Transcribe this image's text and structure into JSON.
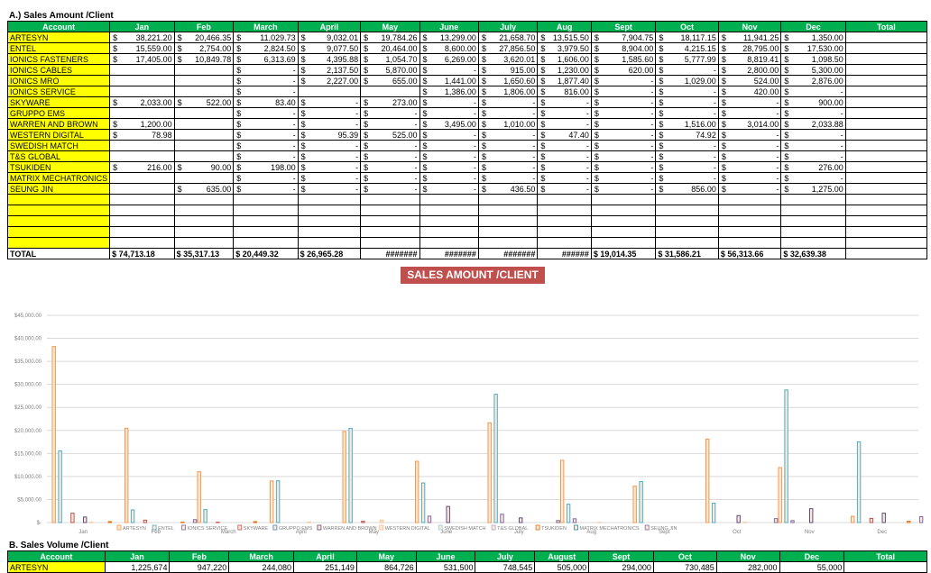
{
  "sectionA": {
    "title": "A.) Sales Amount /Client",
    "headers": [
      "Account",
      "Jan",
      "Feb",
      "March",
      "April",
      "May",
      "June",
      "July",
      "Aug",
      "Sept",
      "Oct",
      "Nov",
      "Dec",
      "Total"
    ],
    "rows": [
      {
        "account": "ARTESYN",
        "values": [
          "38,221.20",
          "20,466.35",
          "11,029.73",
          "9,032.01",
          "19,784.26",
          "13,299.00",
          "21,658.70",
          "13,515.50",
          "7,904.75",
          "18,117.15",
          "11,941.25",
          "1,350.00",
          ""
        ]
      },
      {
        "account": "ENTEL",
        "values": [
          "15,559.00",
          "2,754.00",
          "2,824.50",
          "9,077.50",
          "20,464.00",
          "8,600.00",
          "27,856.50",
          "3,979.50",
          "8,904.00",
          "4,215.15",
          "28,795.00",
          "17,530.00",
          ""
        ]
      },
      {
        "account": "IONICS FASTENERS",
        "values": [
          "17,405.00",
          "10,849.78",
          "6,313.69",
          "4,395.88",
          "1,054.70",
          "6,269.00",
          "3,620.01",
          "1,606.00",
          "1,585.60",
          "5,777.99",
          "8,819.41",
          "1,098.50",
          ""
        ]
      },
      {
        "account": "IONICS CABLES",
        "values": [
          "",
          "",
          "-",
          "2,137.50",
          "5,870.00",
          "-",
          "915.00",
          "1,230.00",
          "620.00",
          "-",
          "2,800.00",
          "5,300.00",
          ""
        ]
      },
      {
        "account": "IONICS MRO",
        "values": [
          "",
          "",
          "-",
          "2,227.00",
          "655.00",
          "1,441.00",
          "1,650.60",
          "1,877.40",
          "-",
          "1,029.00",
          "524.00",
          "2,876.00",
          ""
        ]
      },
      {
        "account": "IONICS SERVICE",
        "values": [
          "",
          "",
          "-",
          "",
          "",
          "1,386.00",
          "1,806.00",
          "816.00",
          "-",
          "-",
          "420.00",
          "-",
          ""
        ]
      },
      {
        "account": "SKYWARE",
        "values": [
          "2,033.00",
          "522.00",
          "83.40",
          "-",
          "273.00",
          "-",
          "-",
          "-",
          "-",
          "-",
          "-",
          "900.00",
          ""
        ]
      },
      {
        "account": "GRUPPO EMS",
        "values": [
          "",
          "",
          "-",
          "-",
          "-",
          "-",
          "-",
          "-",
          "-",
          "-",
          "-",
          "-",
          ""
        ]
      },
      {
        "account": "WARREN AND BROWN",
        "values": [
          "1,200.00",
          "",
          "-",
          "-",
          "-",
          "3,495.00",
          "1,010.00",
          "-",
          "-",
          "1,516.00",
          "3,014.00",
          "2,033.88",
          ""
        ]
      },
      {
        "account": "WESTERN DIGITAL",
        "values": [
          "78.98",
          "",
          "-",
          "95.39",
          "525.00",
          "-",
          "-",
          "47.40",
          "-",
          "74.92",
          "-",
          "-",
          ""
        ]
      },
      {
        "account": "SWEDISH MATCH",
        "values": [
          "",
          "",
          "-",
          "-",
          "-",
          "-",
          "-",
          "-",
          "-",
          "-",
          "-",
          "-",
          ""
        ]
      },
      {
        "account": "T&S GLOBAL",
        "values": [
          "",
          "",
          "-",
          "-",
          "-",
          "-",
          "-",
          "-",
          "-",
          "-",
          "-",
          "-",
          ""
        ]
      },
      {
        "account": "TSUKIDEN",
        "values": [
          "216.00",
          "90.00",
          "198.00",
          "-",
          "-",
          "-",
          "-",
          "-",
          "-",
          "-",
          "-",
          "276.00",
          ""
        ]
      },
      {
        "account": "MATRIX MECHATRONICS",
        "values": [
          "",
          "",
          "-",
          "-",
          "-",
          "-",
          "-",
          "-",
          "-",
          "-",
          "-",
          "-",
          ""
        ]
      },
      {
        "account": "SEUNG JIN",
        "values": [
          "",
          "635.00",
          "-",
          "-",
          "-",
          "-",
          "436.50",
          "-",
          "-",
          "856.00",
          "-",
          "1,275.00",
          ""
        ]
      },
      {
        "account": "",
        "values": [
          "",
          "",
          "",
          "",
          "",
          "",
          "",
          "",
          "",
          "",
          "",
          "",
          ""
        ]
      },
      {
        "account": "",
        "values": [
          "",
          "",
          "",
          "",
          "",
          "",
          "",
          "",
          "",
          "",
          "",
          "",
          ""
        ]
      },
      {
        "account": "",
        "values": [
          "",
          "",
          "",
          "",
          "",
          "",
          "",
          "",
          "",
          "",
          "",
          "",
          ""
        ]
      },
      {
        "account": "",
        "values": [
          "",
          "",
          "",
          "",
          "",
          "",
          "",
          "",
          "",
          "",
          "",
          "",
          ""
        ]
      },
      {
        "account": "",
        "values": [
          "",
          "",
          "",
          "",
          "",
          "",
          "",
          "",
          "",
          "",
          "",
          "",
          ""
        ]
      }
    ],
    "total": {
      "label": "TOTAL",
      "values": [
        "$ 74,713.18",
        "$ 35,317.13",
        "$ 20,449.32",
        "$ 26,965.28",
        "#######",
        "#######",
        "#######",
        "######",
        "$ 19,014.35",
        "$ 31,586.21",
        "$ 56,313.66",
        "$ 32,639.38",
        ""
      ]
    }
  },
  "chart_title": "SALES AMOUNT /CLIENT",
  "sectionB": {
    "title": "B. Sales Volume /Client",
    "headers": [
      "Account",
      "Jan",
      "Feb",
      "March",
      "April",
      "May",
      "June",
      "July",
      "August",
      "Sept",
      "Oct",
      "Nov",
      "Dec",
      "Total"
    ],
    "first_row": {
      "account": "ARTESYN",
      "values": [
        "1,225,674",
        "947,220",
        "244,080",
        "251,149",
        "864,726",
        "531,500",
        "748,545",
        "505,000",
        "294,000",
        "730,485",
        "282,000",
        "55,000",
        ""
      ]
    }
  },
  "chart_data": {
    "type": "bar",
    "title": "",
    "categories": [
      "Jan",
      "Feb",
      "March",
      "April",
      "May",
      "June",
      "July",
      "Aug",
      "Sept",
      "Oct",
      "Nov",
      "Dec"
    ],
    "ylim": [
      0,
      45000
    ],
    "yticks": [
      "$-",
      "$5,000.00",
      "$10,000.00",
      "$15,000.00",
      "$20,000.00",
      "$25,000.00",
      "$30,000.00",
      "$35,000.00",
      "$40,000.00",
      "$45,000.00"
    ],
    "legend_position": "bottom",
    "series": [
      {
        "name": "ARTESYN",
        "color": "#f79646",
        "values": [
          38221.2,
          20466.35,
          11029.73,
          9032.01,
          19784.26,
          13299,
          21658.7,
          13515.5,
          7904.75,
          18117.15,
          11941.25,
          1350
        ]
      },
      {
        "name": "ENTEL",
        "color": "#4bacc6",
        "values": [
          15559,
          2754,
          2824.5,
          9077.5,
          20464,
          8600,
          27856.5,
          3979.5,
          8904,
          4215.15,
          28795,
          17530
        ]
      },
      {
        "name": "IONICS SERVICE",
        "color": "#8064a2",
        "values": [
          0,
          0,
          0,
          0,
          0,
          1386,
          1806,
          816,
          0,
          0,
          420,
          0
        ]
      },
      {
        "name": "SKYWARE",
        "color": "#c0504d",
        "values": [
          2033,
          522,
          83.4,
          0,
          273,
          0,
          0,
          0,
          0,
          0,
          0,
          900
        ]
      },
      {
        "name": "GRUPPO EMS",
        "color": "#4f81bd",
        "values": [
          0,
          0,
          0,
          0,
          0,
          0,
          0,
          0,
          0,
          0,
          0,
          0
        ]
      },
      {
        "name": "WARREN AND BROWN",
        "color": "#604a7b",
        "values": [
          1200,
          0,
          0,
          0,
          0,
          3495,
          1010,
          0,
          0,
          1516,
          3014,
          2033.88
        ]
      },
      {
        "name": "WESTERN DIGITAL",
        "color": "#fabf8f",
        "values": [
          78.98,
          0,
          0,
          95.39,
          525,
          0,
          0,
          47.4,
          0,
          74.92,
          0,
          0
        ]
      },
      {
        "name": "SWEDISH MATCH",
        "color": "#92cddc",
        "values": [
          0,
          0,
          0,
          0,
          0,
          0,
          0,
          0,
          0,
          0,
          0,
          0
        ]
      },
      {
        "name": "T&S GLOBAL",
        "color": "#b3a2c7",
        "values": [
          0,
          0,
          0,
          0,
          0,
          0,
          0,
          0,
          0,
          0,
          0,
          0
        ]
      },
      {
        "name": "TSUKIDEN",
        "color": "#e46c0a",
        "values": [
          216,
          90,
          198,
          0,
          0,
          0,
          0,
          0,
          0,
          0,
          0,
          276
        ]
      },
      {
        "name": "MATRIX MECHATRONICS",
        "color": "#31859c",
        "values": [
          0,
          0,
          0,
          0,
          0,
          0,
          0,
          0,
          0,
          0,
          0,
          0
        ]
      },
      {
        "name": "SEUNG JIN",
        "color": "#7f6a9f",
        "values": [
          0,
          635,
          0,
          0,
          0,
          0,
          436.5,
          0,
          0,
          856,
          0,
          1275
        ]
      }
    ]
  }
}
